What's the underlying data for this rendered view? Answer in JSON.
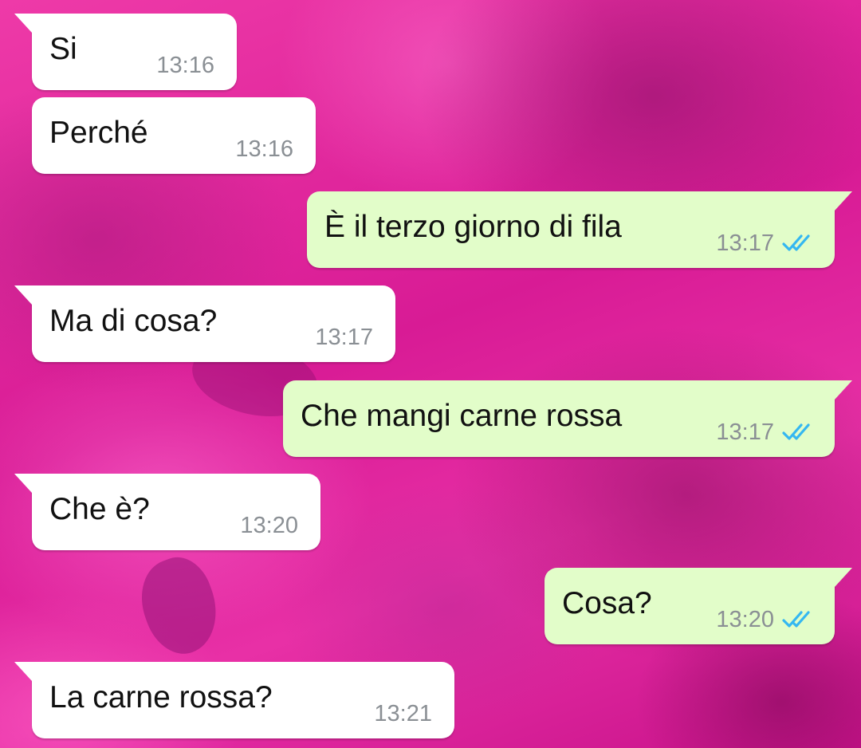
{
  "chat": {
    "messages": [
      {
        "direction": "incoming",
        "text": "Si",
        "time": "13:16"
      },
      {
        "direction": "incoming",
        "text": "Perché",
        "time": "13:16"
      },
      {
        "direction": "outgoing",
        "text": "È il terzo giorno di fila",
        "time": "13:17",
        "status": "read",
        "status_icon": "double-check-icon"
      },
      {
        "direction": "incoming",
        "text": "Ma di cosa?",
        "time": "13:17"
      },
      {
        "direction": "outgoing",
        "text": "Che mangi carne rossa",
        "time": "13:17",
        "status": "read",
        "status_icon": "double-check-icon"
      },
      {
        "direction": "incoming",
        "text": " Che è?",
        "time": "13:20"
      },
      {
        "direction": "outgoing",
        "text": "Cosa?",
        "time": "13:20",
        "status": "read",
        "status_icon": "double-check-icon"
      },
      {
        "direction": "incoming",
        "text": "La carne rossa?",
        "time": "13:21"
      }
    ]
  },
  "colors": {
    "incoming_bubble": "#ffffff",
    "outgoing_bubble": "#e2fdc9",
    "time_text": "#8a8f94",
    "read_ticks": "#34b7f1",
    "wallpaper_base": "#e8239f"
  }
}
